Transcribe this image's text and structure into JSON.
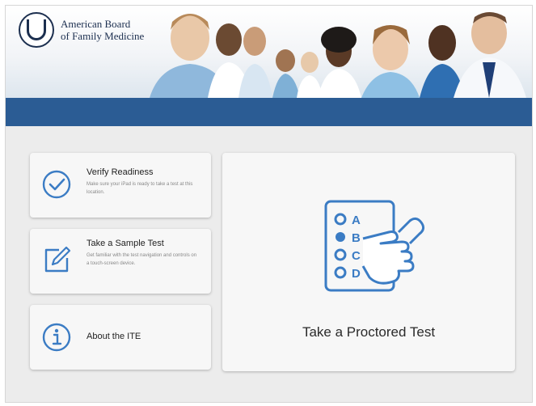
{
  "banner": {
    "logo_line1": "American Board",
    "logo_line2": "of Family Medicine"
  },
  "cards": {
    "verify": {
      "title": "Verify Readiness",
      "description": "Make sure your iPad is ready to take a test at this location.",
      "icon": "checkmark-circle-icon"
    },
    "sample": {
      "title": "Take a Sample Test",
      "description": "Get familiar with the test navigation and controls on a touch-screen device.",
      "icon": "edit-pencil-icon"
    },
    "about": {
      "title": "About the ITE",
      "icon": "info-circle-icon"
    },
    "proctored": {
      "title": "Take a Proctored Test",
      "icon": "answer-sheet-tap-icon",
      "options": [
        "A",
        "B",
        "C",
        "D"
      ]
    }
  },
  "colors": {
    "accent": "#2b5c94",
    "icon_blue": "#3b7cc4"
  }
}
